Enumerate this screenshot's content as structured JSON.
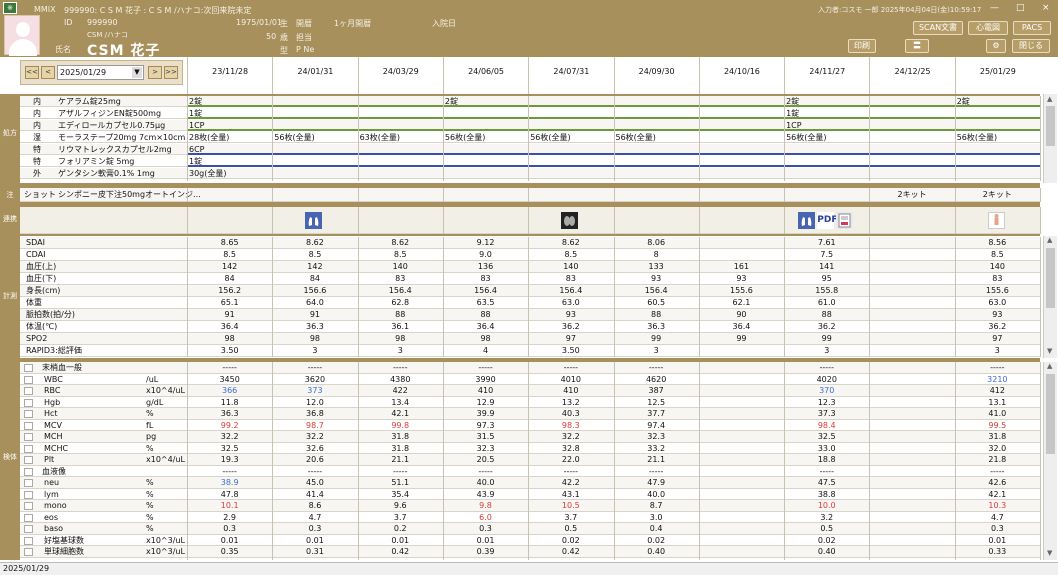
{
  "header": {
    "app_name": "MMIX",
    "patient_line": "999990: C S M  花子 : C S M  /ハナコ:次回来院未定",
    "id_label": "ID",
    "id_value": "999990",
    "kana": "CSM /ハナコ",
    "name_label": "氏名",
    "name": "CSM  花子",
    "birth": "1975/01/01",
    "birth_label": "生",
    "age": "50",
    "age_label": "歳",
    "sex_label": "型",
    "blood": "P Ne",
    "open_label": "開暦",
    "period": "1ヶ月開暦",
    "staff_label": "担当",
    "admit_label": "入院日",
    "input_info": "入力者:コスモ 一郎 2025年04月04日(金)10:59:17",
    "buttons": {
      "scan": "SCAN文書",
      "ecg": "心電図",
      "pacs": "PACS",
      "print": "印刷",
      "close": "閉じる",
      "graph": "〓",
      "settings": "⚙"
    },
    "win": {
      "min": "—",
      "max": "□",
      "close": "×"
    }
  },
  "nav": {
    "first": "<<",
    "prev": "<",
    "date": "2025/01/29",
    "next": ">",
    "last": ">>",
    "dropdown": "▼"
  },
  "dates": [
    "23/11/28",
    "24/01/31",
    "24/03/29",
    "24/06/05",
    "24/07/31",
    "24/09/30",
    "24/10/16",
    "24/11/27",
    "24/12/25",
    "25/01/29"
  ],
  "sections": {
    "prescription": "処方",
    "injection": "注",
    "link": "連携",
    "vitals": "計測",
    "lab": "検体"
  },
  "prescriptions": [
    {
      "type": "内",
      "name": "ケアラム錠25mg",
      "vals": {
        "0": "2錠",
        "3": "2錠",
        "7": "2錠",
        "9": "2錠"
      },
      "bar": "green"
    },
    {
      "type": "内",
      "name": "アザルフィジンEN錠500mg",
      "vals": {
        "0": "1錠",
        "7": "1錠"
      },
      "bar": "green"
    },
    {
      "type": "内",
      "name": "エディロールカプセル0.75μg",
      "vals": {
        "0": "1CP",
        "7": "1CP"
      },
      "bar": "green"
    },
    {
      "type": "湿",
      "name": "モーラステープ20mg 7cm×10cm",
      "vals": {
        "0": "28枚(全量)",
        "1": "56枚(全量)",
        "2": "63枚(全量)",
        "3": "56枚(全量)",
        "4": "56枚(全量)",
        "5": "56枚(全量)",
        "7": "56枚(全量)",
        "9": "56枚(全量)"
      },
      "bar": "none"
    },
    {
      "type": "特",
      "name": "リウマトレックスカプセル2mg",
      "vals": {
        "0": "6CP"
      },
      "bar": "blue"
    },
    {
      "type": "特",
      "name": "フォリアミン錠 5mg",
      "vals": {
        "0": "1錠"
      },
      "bar": "blue"
    },
    {
      "type": "外",
      "name": "ゲンタシン軟膏0.1% 1mg",
      "vals": {
        "0": "30g(全量)"
      },
      "bar": "none"
    }
  ],
  "injection": {
    "type": "ショット",
    "name": "シンポニー皮下注50mgオートインジ...",
    "vals": {
      "8": "2キット",
      "9": "2キット"
    }
  },
  "link_icons": [
    {
      "col": 1,
      "icon": "lung-xray-icon"
    },
    {
      "col": 4,
      "icon": "chest-xray-icon"
    },
    {
      "col": 7,
      "icon": "lung-xray-icon"
    },
    {
      "col": 7,
      "icon": "pdf-icon",
      "label": "PDF"
    },
    {
      "col": 7,
      "icon": "report-icon"
    },
    {
      "col": 9,
      "icon": "body-chart-icon"
    }
  ],
  "vitals": [
    {
      "name": "SDAI",
      "vals": [
        "8.65",
        "8.62",
        "8.62",
        "9.12",
        "8.62",
        "8.06",
        "",
        "7.61",
        "",
        "8.56"
      ]
    },
    {
      "name": "CDAI",
      "vals": [
        "8.5",
        "8.5",
        "8.5",
        "9.0",
        "8.5",
        "8",
        "",
        "7.5",
        "",
        "8.5"
      ]
    },
    {
      "name": "血圧(上)",
      "vals": [
        "142",
        "142",
        "140",
        "136",
        "140",
        "133",
        "161",
        "141",
        "",
        "140"
      ]
    },
    {
      "name": "血圧(下)",
      "vals": [
        "84",
        "84",
        "83",
        "83",
        "83",
        "93",
        "93",
        "95",
        "",
        "83"
      ]
    },
    {
      "name": "身長(cm)",
      "vals": [
        "156.2",
        "156.6",
        "156.4",
        "156.4",
        "156.4",
        "156.4",
        "155.6",
        "155.8",
        "",
        "155.6"
      ]
    },
    {
      "name": "体重",
      "vals": [
        "65.1",
        "64.0",
        "62.8",
        "63.5",
        "63.0",
        "60.5",
        "62.1",
        "61.0",
        "",
        "63.0"
      ]
    },
    {
      "name": "脈拍数(拍/分)",
      "vals": [
        "91",
        "91",
        "88",
        "88",
        "93",
        "88",
        "90",
        "88",
        "",
        "93"
      ]
    },
    {
      "name": "体温(℃)",
      "vals": [
        "36.4",
        "36.3",
        "36.1",
        "36.4",
        "36.2",
        "36.3",
        "36.4",
        "36.2",
        "",
        "36.2"
      ]
    },
    {
      "name": "SPO2",
      "vals": [
        "98",
        "98",
        "98",
        "98",
        "97",
        "99",
        "99",
        "99",
        "",
        "97"
      ]
    },
    {
      "name": "RAPID3:総評価",
      "vals": [
        "3.50",
        "3",
        "3",
        "4",
        "3.50",
        "3",
        "",
        "3",
        "",
        "3"
      ]
    }
  ],
  "labs": [
    {
      "name": "末梢血一般",
      "unit": "",
      "vals": [
        "-----",
        "-----",
        "-----",
        "-----",
        "-----",
        "-----",
        "",
        "-----",
        "",
        "-----"
      ],
      "group": true
    },
    {
      "name": "WBC",
      "unit": "/uL",
      "vals": [
        "3450",
        "3620",
        "4380",
        "3990",
        "4010",
        "4620",
        "",
        "4020",
        "",
        "3210"
      ],
      "c": {
        "9": "L"
      }
    },
    {
      "name": "RBC",
      "unit": "x10^4/uL",
      "vals": [
        "366",
        "373",
        "422",
        "410",
        "410",
        "387",
        "",
        "370",
        "",
        "412"
      ],
      "c": {
        "0": "L",
        "1": "L",
        "7": "L"
      }
    },
    {
      "name": "Hgb",
      "unit": "g/dL",
      "vals": [
        "11.8",
        "12.0",
        "13.4",
        "12.9",
        "13.2",
        "12.5",
        "",
        "12.3",
        "",
        "13.1"
      ]
    },
    {
      "name": "Hct",
      "unit": "%",
      "vals": [
        "36.3",
        "36.8",
        "42.1",
        "39.9",
        "40.3",
        "37.7",
        "",
        "37.3",
        "",
        "41.0"
      ]
    },
    {
      "name": "MCV",
      "unit": "fL",
      "vals": [
        "99.2",
        "98.7",
        "99.8",
        "97.3",
        "98.3",
        "97.4",
        "",
        "98.4",
        "",
        "99.5"
      ],
      "c": {
        "0": "H",
        "1": "H",
        "2": "H",
        "4": "H",
        "7": "H",
        "9": "H"
      }
    },
    {
      "name": "MCH",
      "unit": "pg",
      "vals": [
        "32.2",
        "32.2",
        "31.8",
        "31.5",
        "32.2",
        "32.3",
        "",
        "32.5",
        "",
        "31.8"
      ]
    },
    {
      "name": "MCHC",
      "unit": "%",
      "vals": [
        "32.5",
        "32.6",
        "31.8",
        "32.3",
        "32.8",
        "33.2",
        "",
        "33.0",
        "",
        "32.0"
      ]
    },
    {
      "name": "Plt",
      "unit": "x10^4/uL",
      "vals": [
        "19.3",
        "20.6",
        "21.1",
        "20.5",
        "22.0",
        "21.1",
        "",
        "18.8",
        "",
        "21.8"
      ]
    },
    {
      "name": "血液像",
      "unit": "",
      "vals": [
        "-----",
        "-----",
        "-----",
        "-----",
        "-----",
        "-----",
        "",
        "-----",
        "",
        "-----"
      ],
      "group": true
    },
    {
      "name": "neu",
      "unit": "%",
      "vals": [
        "38.9",
        "45.0",
        "51.1",
        "40.0",
        "42.2",
        "47.9",
        "",
        "47.5",
        "",
        "42.6"
      ],
      "c": {
        "0": "L"
      }
    },
    {
      "name": "lym",
      "unit": "%",
      "vals": [
        "47.8",
        "41.4",
        "35.4",
        "43.9",
        "43.1",
        "40.0",
        "",
        "38.8",
        "",
        "42.1"
      ]
    },
    {
      "name": "mono",
      "unit": "%",
      "vals": [
        "10.1",
        "8.6",
        "9.6",
        "9.8",
        "10.5",
        "8.7",
        "",
        "10.0",
        "",
        "10.3"
      ],
      "c": {
        "0": "H",
        "3": "H",
        "4": "H",
        "7": "H",
        "9": "H"
      }
    },
    {
      "name": "eos",
      "unit": "%",
      "vals": [
        "2.9",
        "4.7",
        "3.7",
        "6.0",
        "3.7",
        "3.0",
        "",
        "3.2",
        "",
        "4.7"
      ],
      "c": {
        "3": "H"
      }
    },
    {
      "name": "baso",
      "unit": "%",
      "vals": [
        "0.3",
        "0.3",
        "0.2",
        "0.3",
        "0.5",
        "0.4",
        "",
        "0.5",
        "",
        "0.3"
      ]
    },
    {
      "name": "好塩基球数",
      "unit": "x10^3/uL",
      "vals": [
        "0.01",
        "0.01",
        "0.01",
        "0.01",
        "0.02",
        "0.02",
        "",
        "0.02",
        "",
        "0.01"
      ]
    },
    {
      "name": "単球細胞数",
      "unit": "x10^3/uL",
      "vals": [
        "0.35",
        "0.31",
        "0.42",
        "0.39",
        "0.42",
        "0.40",
        "",
        "0.40",
        "",
        "0.33"
      ]
    }
  ],
  "colors": {
    "header": "#a8905c",
    "high": "#e03a3a",
    "low": "#3a6fd0",
    "green_bar": "#6a9a3a",
    "blue_bar": "#3a4fa8"
  },
  "status": {
    "date": "2025/01/29"
  }
}
